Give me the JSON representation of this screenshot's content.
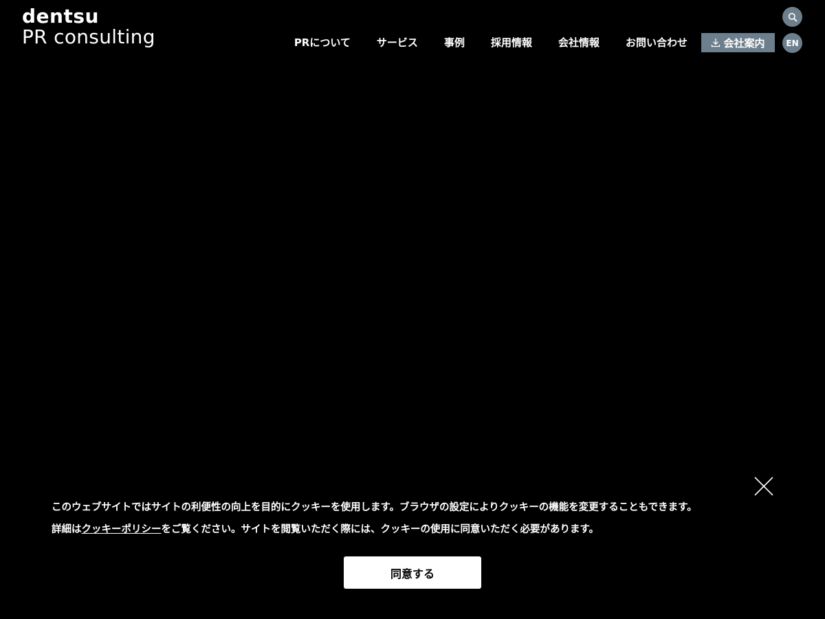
{
  "header": {
    "logo_line1": "dentsu",
    "logo_line2": "PR consulting",
    "nav_items": [
      {
        "label": "PRについて"
      },
      {
        "label": "サービス"
      },
      {
        "label": "事例"
      },
      {
        "label": "採用情報"
      },
      {
        "label": "会社情報"
      },
      {
        "label": "お問い合わせ"
      }
    ],
    "brochure_label": "会社案内",
    "brochure_icon": "download-icon",
    "search_icon": "search-icon",
    "lang_label": "EN"
  },
  "cookie_banner": {
    "line1": "このウェブサイトではサイトの利便性の向上を目的にクッキーを使用します。ブラウザの設定によりクッキーの機能を変更することもできます。",
    "line2_prefix": "詳細は",
    "policy_link": "クッキーポリシー",
    "line2_suffix": "をご覧ください。サイトを閲覧いただく際には、クッキーの使用に同意いただく必要があります。",
    "agree_label": "同意する",
    "close_icon": "close-icon"
  },
  "colors": {
    "background": "#000000",
    "accent": "#6d7f8c",
    "text": "#ffffff"
  }
}
